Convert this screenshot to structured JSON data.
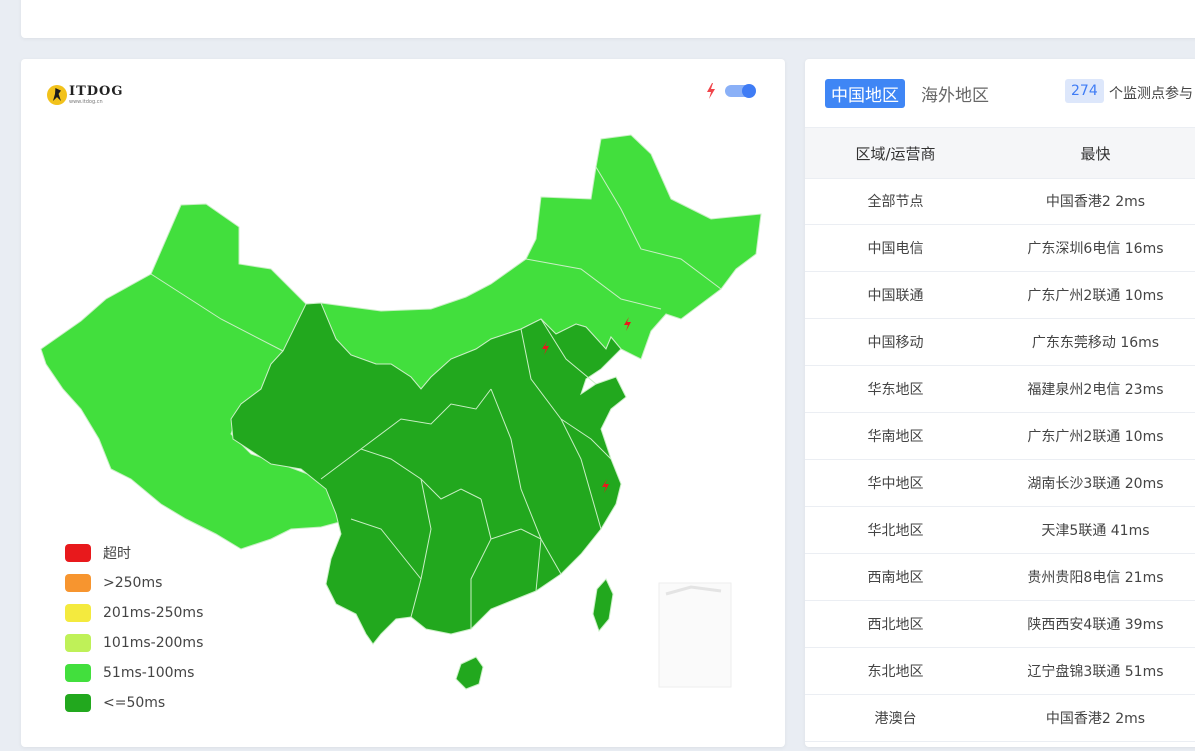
{
  "map_panel": {
    "logo": {
      "title": "ITDOG",
      "subtitle": "www.itdog.cn"
    },
    "toggle_on": true,
    "legend": [
      {
        "label": "超时",
        "color": "#e8191c"
      },
      {
        "label": ">250ms",
        "color": "#f7952f"
      },
      {
        "label": "201ms-250ms",
        "color": "#f4ea3e"
      },
      {
        "label": "101ms-200ms",
        "color": "#bff158"
      },
      {
        "label": "51ms-100ms",
        "color": "#42df3d"
      },
      {
        "label": "<=50ms",
        "color": "#22a81e"
      }
    ],
    "map_colors": {
      "light": "#42df3d",
      "dark": "#22a81e",
      "border": "#c8efc4"
    }
  },
  "table_panel": {
    "tabs": [
      {
        "label": "中国地区",
        "active": true
      },
      {
        "label": "海外地区",
        "active": false
      }
    ],
    "node_count": "274",
    "node_count_suffix": "个监测点参与",
    "headers": {
      "region": "区域/运营商",
      "fastest": "最快"
    },
    "rows": [
      {
        "region": "全部节点",
        "fastest": "中国香港2 2ms"
      },
      {
        "region": "中国电信",
        "fastest": "广东深圳6电信 16ms"
      },
      {
        "region": "中国联通",
        "fastest": "广东广州2联通 10ms"
      },
      {
        "region": "中国移动",
        "fastest": "广东东莞移动 16ms"
      },
      {
        "region": "华东地区",
        "fastest": "福建泉州2电信 23ms"
      },
      {
        "region": "华南地区",
        "fastest": "广东广州2联通 10ms"
      },
      {
        "region": "华中地区",
        "fastest": "湖南长沙3联通 20ms"
      },
      {
        "region": "华北地区",
        "fastest": "天津5联通 41ms"
      },
      {
        "region": "西南地区",
        "fastest": "贵州贵阳8电信 21ms"
      },
      {
        "region": "西北地区",
        "fastest": "陕西西安4联通 39ms"
      },
      {
        "region": "东北地区",
        "fastest": "辽宁盘锦3联通 51ms"
      },
      {
        "region": "港澳台",
        "fastest": "中国香港2 2ms"
      }
    ]
  }
}
